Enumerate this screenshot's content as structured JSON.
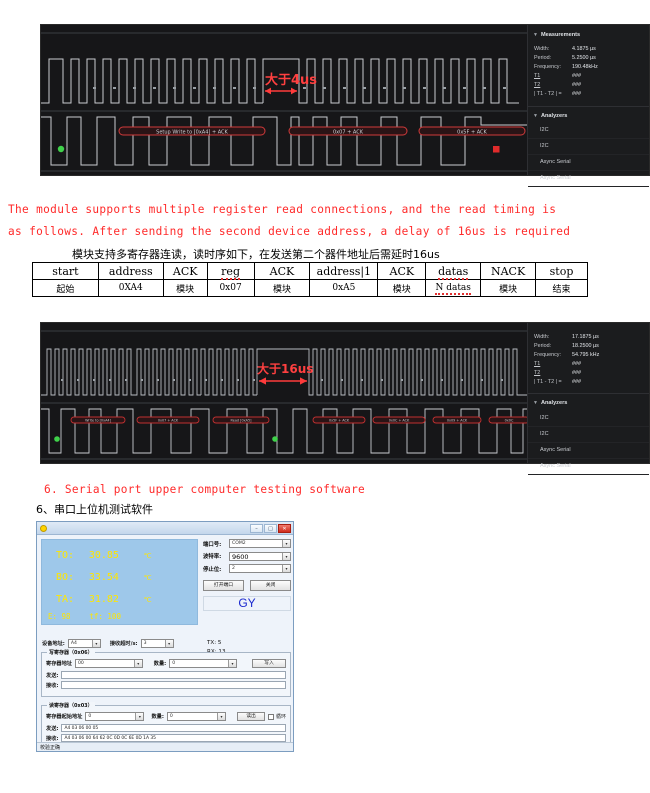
{
  "capture_top": {
    "annotation": "大于4us",
    "bus_labels": [
      "Setup Write to [0xA4] + ACK",
      "0x07 + ACK",
      "0x5F + ACK"
    ],
    "measurements": {
      "header": "Measurements",
      "rows": [
        {
          "key": "Width:",
          "value": "4.1875 µs"
        },
        {
          "key": "Period:",
          "value": "5.2500 µs"
        },
        {
          "key": "Frequency:",
          "value": "190.48kHz"
        },
        {
          "key": "T1",
          "value": "###"
        },
        {
          "key": "T2",
          "value": "###"
        },
        {
          "key": "| T1 - T2 | =",
          "value": "###"
        }
      ]
    },
    "analyzers": {
      "header": "Analyzers",
      "items": [
        "I2C",
        "I2C",
        "Async Serial",
        "Async Serial"
      ]
    }
  },
  "paragraph": {
    "english_line1": "The module supports multiple register read connections, and the read timing is",
    "english_line2": "as follows. After sending the second device address, a delay of 16us is required",
    "chinese": "模块支持多寄存器连读，读时序如下，在发送第二个器件地址后需延时16us"
  },
  "seq_table": {
    "row_en": [
      "start",
      "address",
      "ACK",
      "reg",
      "ACK",
      "address|1",
      "ACK",
      "datas",
      "NACK",
      "stop"
    ],
    "row_cn": [
      "起始",
      "0XA4",
      "模块",
      "0x07",
      "模块",
      "0xA5",
      "模块",
      "N datas",
      "模块",
      "结束"
    ],
    "squiggly_en": [
      false,
      false,
      false,
      true,
      false,
      false,
      false,
      true,
      false,
      false
    ],
    "squiggly_cn": [
      false,
      false,
      false,
      false,
      false,
      false,
      false,
      true,
      false,
      false
    ]
  },
  "capture_bottom": {
    "annotation": "大于16us",
    "bus_labels": [
      "Write to [0xA4]",
      "0x07 + ACK",
      "Read [0xA5]",
      "0x5F + ACK",
      "0x0C + ACK",
      "0x09 + ACK",
      "0x0C + ACK",
      "0x6E + ACK",
      "0x0C + ACK",
      "0x0D"
    ],
    "measurements": {
      "header": "Measurements",
      "rows": [
        {
          "key": "Width:",
          "value": "17.1875 µs"
        },
        {
          "key": "Period:",
          "value": "18.2500 µs"
        },
        {
          "key": "Frequency:",
          "value": "54.795 kHz"
        },
        {
          "key": "T1",
          "value": "###"
        },
        {
          "key": "T2",
          "value": "###"
        },
        {
          "key": "| T1 - T2 | =",
          "value": "###"
        }
      ]
    },
    "analyzers": {
      "header": "Analyzers",
      "items": [
        "I2C",
        "I2C",
        "Async Serial",
        "Async Serial"
      ]
    }
  },
  "section6": {
    "english": "6. Serial port upper computer testing software",
    "chinese": "6、串口上位机测试软件"
  },
  "app": {
    "title": "",
    "window_buttons": {
      "minimize": "–",
      "maximize": "□",
      "close": "✕"
    },
    "readout": {
      "rows": [
        {
          "label": "TO:",
          "value": "30.85",
          "unit": "℃"
        },
        {
          "label": "BO:",
          "value": "33.54",
          "unit": "℃"
        },
        {
          "label": "TA:",
          "value": "31.82",
          "unit": "℃"
        }
      ],
      "footer_left": "E: 98",
      "footer_right": "tf: 100"
    },
    "serial": {
      "port_label": "端口号:",
      "port_value": "COM2",
      "baud_label": "波特率:",
      "baud_value": "9600",
      "stopbits_label": "停止位:",
      "stopbits_value": "2",
      "open_button": "打开端口",
      "close_button": "关闭",
      "logo": "GY"
    },
    "counters": {
      "tx": "TX: 5",
      "rx": "RX: 13"
    },
    "device": {
      "addr_label": "设备地址:",
      "addr_value": "A4",
      "timeout_label": "接收超时/s:",
      "timeout_value": "3"
    },
    "write_group": {
      "title": "写寄存器（0x06）",
      "reg_label": "寄存器地址",
      "reg_value": "00",
      "count_label": "数量:",
      "count_value": "0",
      "button": "写入",
      "send_label": "发送:",
      "send_value": "",
      "recv_label": "接收:",
      "recv_value": ""
    },
    "read_group": {
      "title": "读寄存器（0x03）",
      "reg_label": "寄存器起始地址",
      "reg_value": "0",
      "count_label": "数量:",
      "count_value": "0",
      "button": "读出",
      "loop_label": "循环",
      "send_label": "发送:",
      "send_value": "A4 03 06 00 05",
      "recv_label": "接收:",
      "recv_value": "A4 03 06 00 64 62 0C 0D 0C 6E 0D 1A 35"
    },
    "status": "校验正确"
  },
  "colors": {
    "red_text": "#ff2a2a",
    "annotation_red": "#ff4040",
    "readout_bg": "#9ec8ea",
    "readout_text": "#ffe600",
    "logo_blue": "#1a28cf"
  }
}
